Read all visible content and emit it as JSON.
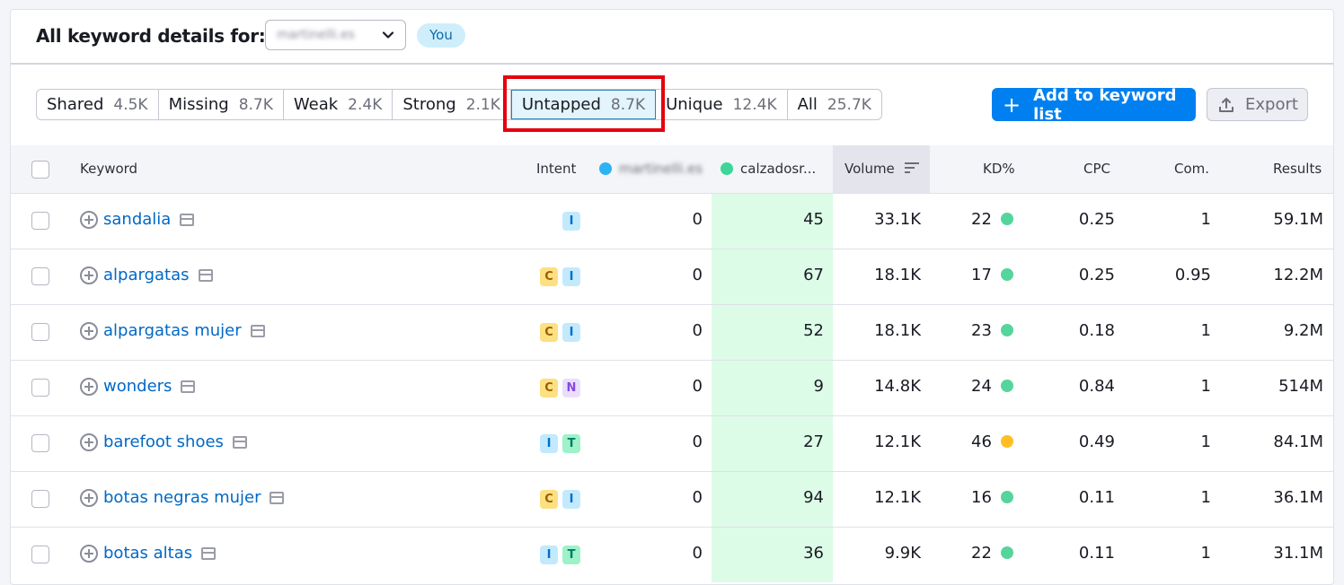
{
  "header": {
    "title": "All keyword details for:",
    "domain_value": "martinelli.es",
    "you_badge": "You"
  },
  "tabs": [
    {
      "label": "Shared",
      "count": "4.5K"
    },
    {
      "label": "Missing",
      "count": "8.7K"
    },
    {
      "label": "Weak",
      "count": "2.4K"
    },
    {
      "label": "Strong",
      "count": "2.1K"
    },
    {
      "label": "Untapped",
      "count": "8.7K",
      "active": true
    },
    {
      "label": "Unique",
      "count": "12.4K"
    },
    {
      "label": "All",
      "count": "25.7K"
    }
  ],
  "actions": {
    "add_label": "Add to keyword list",
    "export_label": "Export"
  },
  "columns": {
    "keyword": "Keyword",
    "intent": "Intent",
    "domain1": "martinelli.es",
    "domain2": "calzadosr...",
    "volume": "Volume",
    "kd": "KD%",
    "cpc": "CPC",
    "com": "Com.",
    "results": "Results"
  },
  "colors": {
    "domain1_dot": "#2bb3f4",
    "domain2_dot": "#3dd598",
    "kd_easy": "#55d59b",
    "kd_medium": "#ffbe26",
    "highlight_box": "#e5000d"
  },
  "rows": [
    {
      "keyword": "sandalia",
      "intents": [
        "I"
      ],
      "d1": "0",
      "d2": "45",
      "volume": "33.1K",
      "kd": "22",
      "kd_level": "easy",
      "cpc": "0.25",
      "com": "1",
      "results": "59.1M"
    },
    {
      "keyword": "alpargatas",
      "intents": [
        "C",
        "I"
      ],
      "d1": "0",
      "d2": "67",
      "volume": "18.1K",
      "kd": "17",
      "kd_level": "easy",
      "cpc": "0.25",
      "com": "0.95",
      "results": "12.2M"
    },
    {
      "keyword": "alpargatas mujer",
      "intents": [
        "C",
        "I"
      ],
      "d1": "0",
      "d2": "52",
      "volume": "18.1K",
      "kd": "23",
      "kd_level": "easy",
      "cpc": "0.18",
      "com": "1",
      "results": "9.2M"
    },
    {
      "keyword": "wonders",
      "intents": [
        "C",
        "N"
      ],
      "d1": "0",
      "d2": "9",
      "volume": "14.8K",
      "kd": "24",
      "kd_level": "easy",
      "cpc": "0.84",
      "com": "1",
      "results": "514M"
    },
    {
      "keyword": "barefoot shoes",
      "intents": [
        "I",
        "T"
      ],
      "d1": "0",
      "d2": "27",
      "volume": "12.1K",
      "kd": "46",
      "kd_level": "medium",
      "cpc": "0.49",
      "com": "1",
      "results": "84.1M"
    },
    {
      "keyword": "botas negras mujer",
      "intents": [
        "C",
        "I"
      ],
      "d1": "0",
      "d2": "94",
      "volume": "12.1K",
      "kd": "16",
      "kd_level": "easy",
      "cpc": "0.11",
      "com": "1",
      "results": "36.1M"
    },
    {
      "keyword": "botas altas",
      "intents": [
        "I",
        "T"
      ],
      "d1": "0",
      "d2": "36",
      "volume": "9.9K",
      "kd": "22",
      "kd_level": "easy",
      "cpc": "0.11",
      "com": "1",
      "results": "31.1M"
    }
  ]
}
